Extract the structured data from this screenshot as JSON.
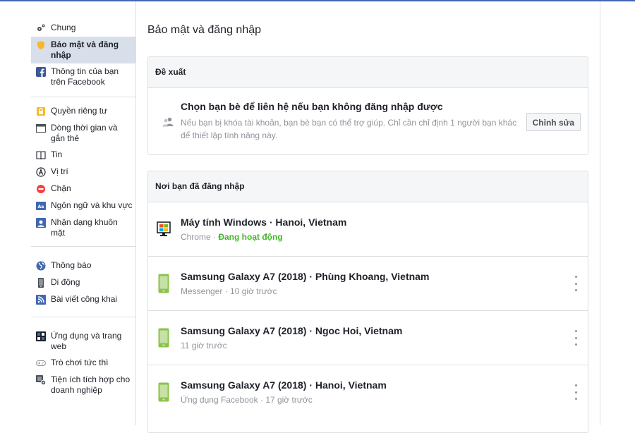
{
  "sidebar": {
    "groups": [
      [
        {
          "label": "Chung"
        },
        {
          "label": "Bảo mật và đăng nhập"
        },
        {
          "label": "Thông tin của bạn trên Facebook"
        }
      ],
      [
        {
          "label": "Quyền riêng tư"
        },
        {
          "label": "Dòng thời gian và gắn thẻ"
        },
        {
          "label": "Tin"
        },
        {
          "label": "Vị trí"
        },
        {
          "label": "Chặn"
        },
        {
          "label": "Ngôn ngữ và khu vực"
        },
        {
          "label": "Nhận dạng khuôn mặt"
        }
      ],
      [
        {
          "label": "Thông báo"
        },
        {
          "label": "Di động"
        },
        {
          "label": "Bài viết công khai"
        }
      ],
      [
        {
          "label": "Ứng dụng và trang web"
        },
        {
          "label": "Trò chơi tức thì"
        },
        {
          "label": "Tiện ích tích hợp cho doanh nghiệp"
        }
      ]
    ]
  },
  "main": {
    "title": "Bảo mật và đăng nhập",
    "suggestions": {
      "header": "Đề xuất",
      "item_title": "Chọn bạn bè để liên hệ nếu bạn không đăng nhập được",
      "item_desc": "Nếu bạn bị khóa tài khoản, bạn bè bạn có thể trợ giúp. Chỉ cần chỉ định 1 người bạn khác để thiết lập tính năng này.",
      "edit_label": "Chỉnh sửa"
    },
    "sessions": {
      "header": "Nơi bạn đã đăng nhập",
      "items": [
        {
          "title": "Máy tính Windows · Hanoi, Vietnam",
          "sub": "Chrome · ",
          "status": "Đang hoạt động"
        },
        {
          "title": "Samsung Galaxy A7 (2018) · Phùng Khoang, Vietnam",
          "sub": "Messenger · 10 giờ trước"
        },
        {
          "title": "Samsung Galaxy A7 (2018) · Ngoc Hoi, Vietnam",
          "sub": "11 giờ trước"
        },
        {
          "title": "Samsung Galaxy A7 (2018) · Hanoi, Vietnam",
          "sub": "Ứng dụng Facebook · 17 giờ trước"
        }
      ]
    }
  },
  "colors": {
    "accent": "#4267b2",
    "active_bg": "#d8dfea",
    "online": "#42b72a",
    "phone": "#8bc34a"
  }
}
